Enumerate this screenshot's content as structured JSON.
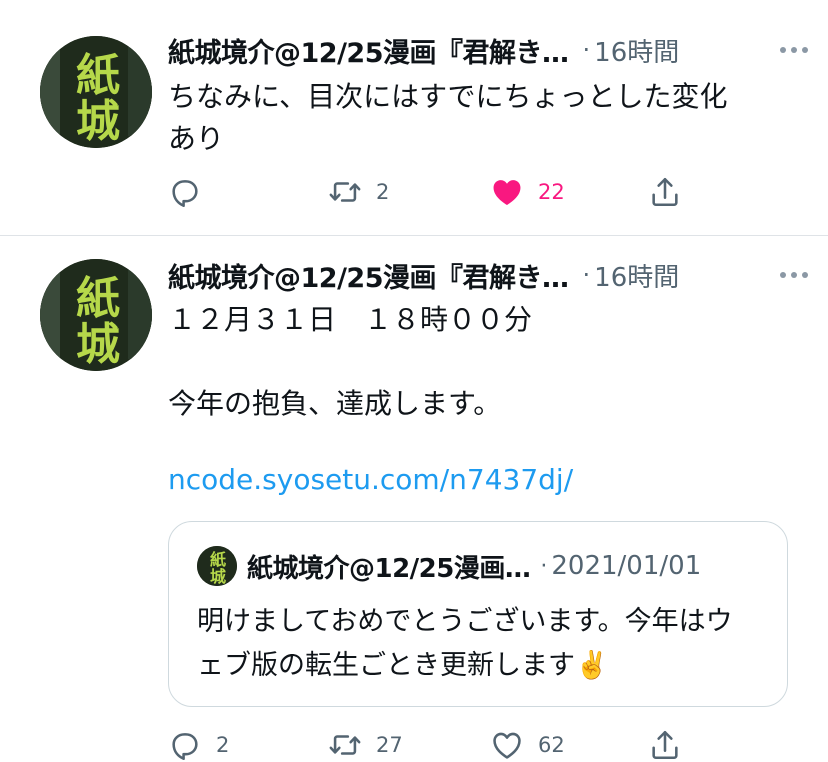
{
  "colors": {
    "text": "#0f1419",
    "secondary": "#536471",
    "link": "#1d9bf0",
    "like": "#f91880",
    "avatar_glyph": "#b6d84a"
  },
  "avatar": {
    "glyph_top": "紙",
    "glyph_bottom": "城"
  },
  "tweets": [
    {
      "author": "紙城境介@12/25漫画『君解き…",
      "separator": "·",
      "time": "16時間",
      "text": "ちなみに、目次にはすでにちょっとした変化\nあり",
      "actions": {
        "reply": "",
        "retweet": "2",
        "like": "22",
        "liked": true
      }
    },
    {
      "author": "紙城境介@12/25漫画『君解き…",
      "separator": "·",
      "time": "16時間",
      "text": "１２月３１日　１８時００分\n\n今年の抱負、達成します。",
      "link": "ncode.syosetu.com/n7437dj/",
      "quote": {
        "author": "紙城境介@12/25漫画…",
        "separator": "·",
        "date": "2021/01/01",
        "text": "明けましておめでとうございます。今年はウェブ版の転生ごとき更新します✌️"
      },
      "actions": {
        "reply": "2",
        "retweet": "27",
        "like": "62",
        "liked": false
      }
    }
  ],
  "icons": {
    "reply": "reply-icon",
    "retweet": "retweet-icon",
    "like": "heart-icon",
    "share": "share-icon",
    "more": "more-icon"
  }
}
